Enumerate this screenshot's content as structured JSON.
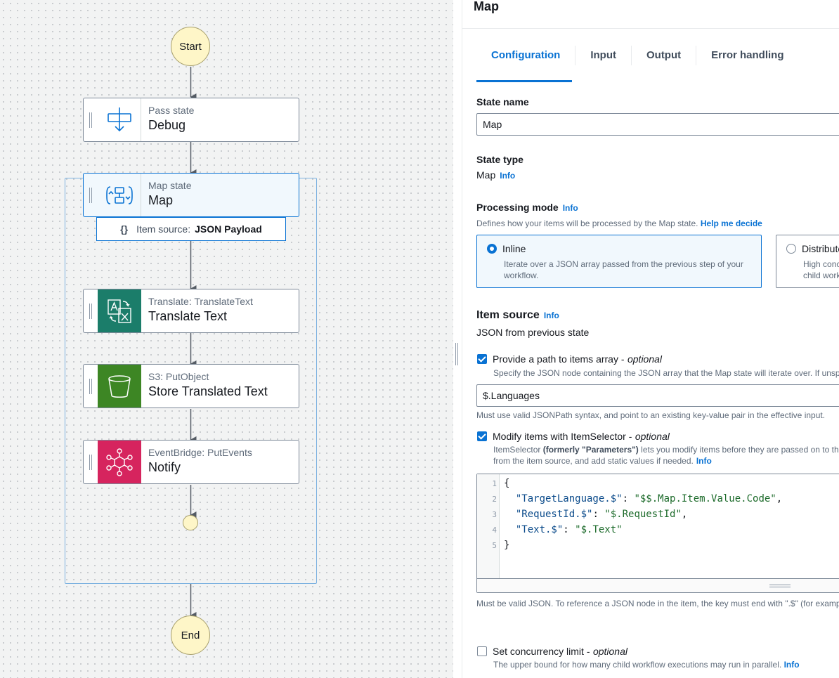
{
  "canvas": {
    "start_label": "Start",
    "end_label": "End",
    "states": [
      {
        "kind": "Pass state",
        "name": "Debug"
      },
      {
        "kind": "Map state",
        "name": "Map"
      },
      {
        "kind": "Translate: TranslateText",
        "name": "Translate Text"
      },
      {
        "kind": "S3: PutObject",
        "name": "Store Translated Text"
      },
      {
        "kind": "EventBridge: PutEvents",
        "name": "Notify"
      }
    ],
    "item_source": {
      "icon": "{}",
      "prefix": "Item source:",
      "value": "JSON Payload"
    }
  },
  "panel": {
    "title": "Map",
    "tabs": [
      {
        "label": "Configuration",
        "active": true
      },
      {
        "label": "Input",
        "active": false
      },
      {
        "label": "Output",
        "active": false
      },
      {
        "label": "Error handling",
        "active": false
      }
    ],
    "state_name": {
      "label": "State name",
      "value": "Map"
    },
    "state_type": {
      "label": "State type",
      "value": "Map",
      "info": "Info"
    },
    "processing_mode": {
      "label": "Processing mode",
      "info": "Info",
      "desc": "Defines how your items will be processed by the Map state.",
      "help_link": "Help me decide",
      "options": [
        {
          "title": "Inline",
          "desc_line1": "Iterate over a JSON array passed from the previous step of your",
          "desc_line2": "workflow.",
          "selected": true
        },
        {
          "title": "Distributed",
          "desc_line1": "High concurrency mode",
          "desc_line2": "child workflow executions",
          "selected": false
        }
      ]
    },
    "item_source": {
      "label": "Item source",
      "info": "Info",
      "value": "JSON from previous state"
    },
    "items_path": {
      "checked": true,
      "label": "Provide a path to items array -",
      "optional": "optional",
      "desc": "Specify the JSON node containing the JSON array that the Map state will iterate over. If unspecified, the entire input is used.",
      "value": "$.Languages",
      "hint": "Must use valid JSONPath syntax, and point to an existing key-value pair in the effective input."
    },
    "item_selector": {
      "checked": true,
      "label": "Modify items with ItemSelector -",
      "optional": "optional",
      "desc_a": "ItemSelector",
      "desc_b": "(formerly \"Parameters\")",
      "desc_c": "lets you modify items before they are passed on to the iteration",
      "desc_line2": "from the item source, and add static values if needed.",
      "info": "Info",
      "code_lines": [
        {
          "n": "1",
          "text": "{"
        },
        {
          "n": "2",
          "key": "\"TargetLanguage.$\"",
          "sep": ": ",
          "val": "\"$$.Map.Item.Value.Code\"",
          "end": ","
        },
        {
          "n": "3",
          "key": "\"RequestId.$\"",
          "sep": ": ",
          "val": "\"$.RequestId\"",
          "end": ","
        },
        {
          "n": "4",
          "key": "\"Text.$\"",
          "sep": ": ",
          "val": "\"$.Text\"",
          "end": ""
        },
        {
          "n": "5",
          "text": "}"
        }
      ],
      "hint": "Must be valid JSON. To reference a JSON node in the item, the key must end with \".$\" (for example"
    },
    "concurrency": {
      "checked": false,
      "label": "Set concurrency limit -",
      "optional": "optional",
      "desc": "The upper bound for how many child workflow executions may run in parallel.",
      "info": "Info"
    }
  },
  "colors": {
    "accent": "#0972d3",
    "terminal_fill": "#fef6c8",
    "translate_icon": "#1b7d6a",
    "s3_icon": "#3d8624",
    "eventbridge_icon": "#d6245e"
  }
}
